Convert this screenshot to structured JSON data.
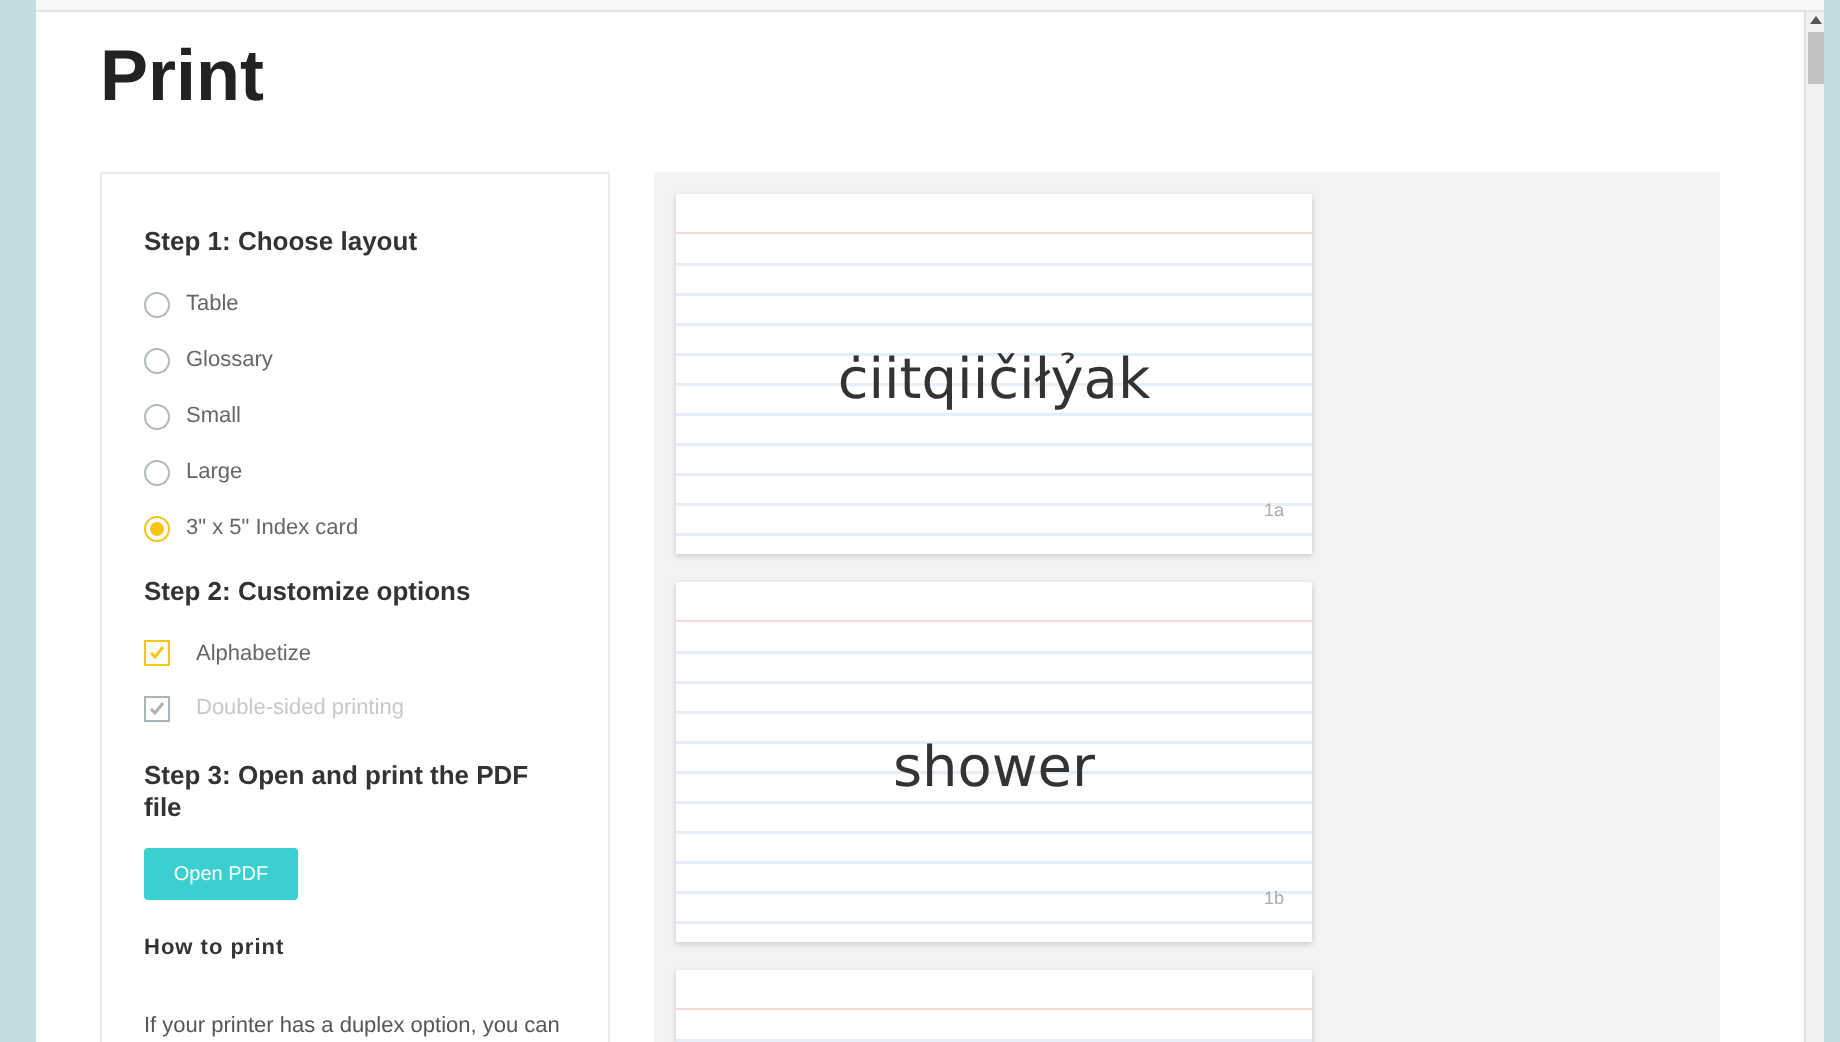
{
  "page": {
    "title": "Print"
  },
  "steps": [
    {
      "kind": "radio",
      "heading": "Step 1: Choose layout",
      "options": [
        {
          "label": "Table",
          "selected": false
        },
        {
          "label": "Glossary",
          "selected": false
        },
        {
          "label": "Small",
          "selected": false
        },
        {
          "label": "Large",
          "selected": false
        },
        {
          "label": "3\" x 5\" Index card",
          "selected": true
        }
      ]
    },
    {
      "kind": "checkbox",
      "heading": "Step 2: Customize options",
      "options": [
        {
          "label": "Alphabetize",
          "checked": true,
          "disabled": false
        },
        {
          "label": "Double-sided printing",
          "checked": true,
          "disabled": true
        }
      ]
    },
    {
      "kind": "button",
      "heading": "Step 3: Open and print the PDF file",
      "button": "Open PDF"
    }
  ],
  "how_to_print": {
    "heading": "How to print",
    "text": "If your printer has a duplex option, you can"
  },
  "cards": [
    {
      "kind": "word",
      "word": "ċiitqiičiłỷak",
      "number": "1a"
    },
    {
      "kind": "word",
      "word": "shower",
      "number": "1b"
    },
    {
      "kind": "blank"
    }
  ]
}
